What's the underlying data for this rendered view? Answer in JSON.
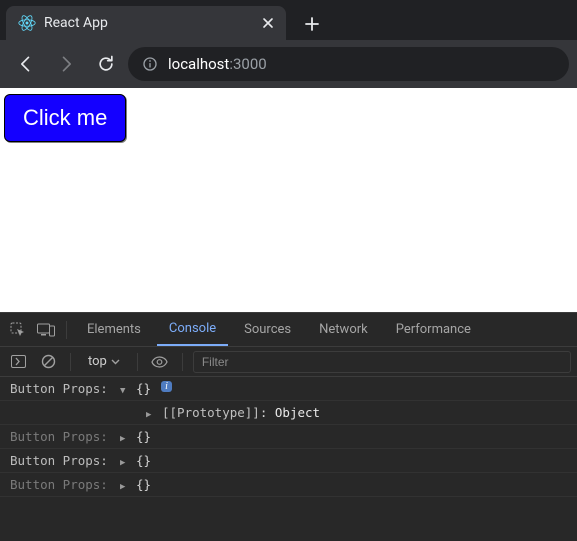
{
  "browser": {
    "tab": {
      "title": "React App"
    },
    "url": {
      "host": "localhost",
      "port": ":3000"
    }
  },
  "page": {
    "button_label": "Click me"
  },
  "devtools": {
    "tabs": {
      "elements": "Elements",
      "console": "Console",
      "sources": "Sources",
      "network": "Network",
      "performance": "Performance"
    },
    "context": "top",
    "filter_placeholder": "Filter",
    "console_rows": [
      {
        "source": "Button Props:",
        "expanded": true,
        "object": "{}",
        "info_badge": "i",
        "prototype_line": {
          "key": "[[Prototype]]",
          "val": "Object"
        }
      },
      {
        "source": "Button Props:",
        "expanded": false,
        "object": "{}",
        "dim": true
      },
      {
        "source": "Button Props:",
        "expanded": false,
        "object": "{}"
      },
      {
        "source": "Button Props:",
        "expanded": false,
        "object": "{}",
        "dim": true
      }
    ]
  }
}
